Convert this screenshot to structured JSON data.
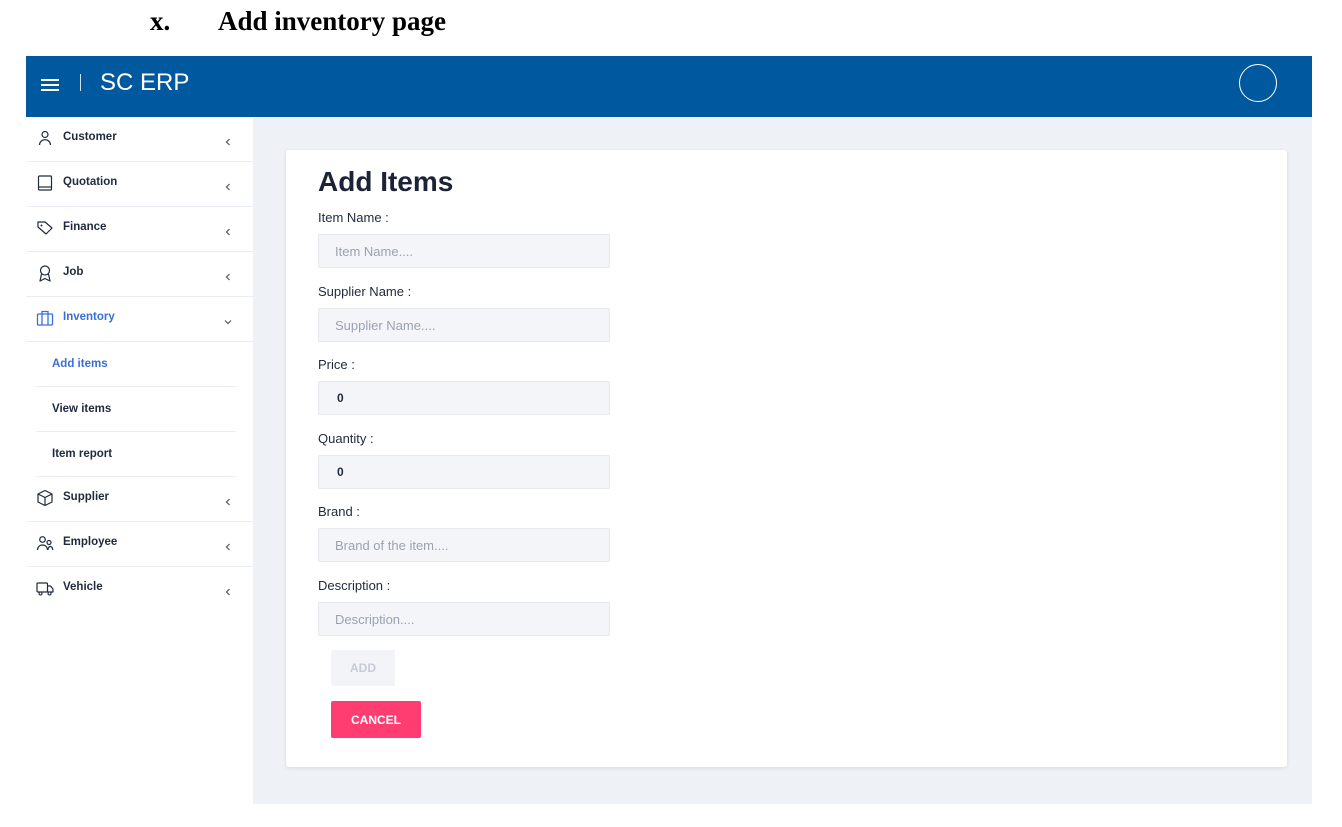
{
  "caption": {
    "number": "x.",
    "title": "Add inventory page"
  },
  "header": {
    "brand": "SC ERP"
  },
  "sidebar": {
    "items": [
      {
        "label": "Customer",
        "icon": "person-icon"
      },
      {
        "label": "Quotation",
        "icon": "book-icon"
      },
      {
        "label": "Finance",
        "icon": "tag-icon"
      },
      {
        "label": "Job",
        "icon": "award-icon"
      },
      {
        "label": "Inventory",
        "icon": "briefcase-icon",
        "expanded": true
      },
      {
        "label": "Supplier",
        "icon": "cube-icon"
      },
      {
        "label": "Employee",
        "icon": "people-icon"
      },
      {
        "label": "Vehicle",
        "icon": "truck-icon"
      }
    ],
    "inventory_sub": [
      {
        "label": "Add items",
        "active": true
      },
      {
        "label": "View items"
      },
      {
        "label": "Item report"
      }
    ]
  },
  "form": {
    "title": "Add Items",
    "fields": [
      {
        "label": "Item Name :",
        "value": "",
        "placeholder": "Item Name...."
      },
      {
        "label": "Supplier Name :",
        "value": "",
        "placeholder": "Supplier Name...."
      },
      {
        "label": "Price :",
        "value": "0",
        "placeholder": ""
      },
      {
        "label": "Quantity :",
        "value": "0",
        "placeholder": ""
      },
      {
        "label": "Brand :",
        "value": "",
        "placeholder": "Brand of the item...."
      },
      {
        "label": "Description :",
        "value": "",
        "placeholder": "Description...."
      }
    ],
    "add_label": "ADD",
    "cancel_label": "CANCEL"
  },
  "colors": {
    "header": "#00589f",
    "active": "#3a6fd6",
    "cancel": "#ff3d71",
    "background": "#eef1f6"
  }
}
